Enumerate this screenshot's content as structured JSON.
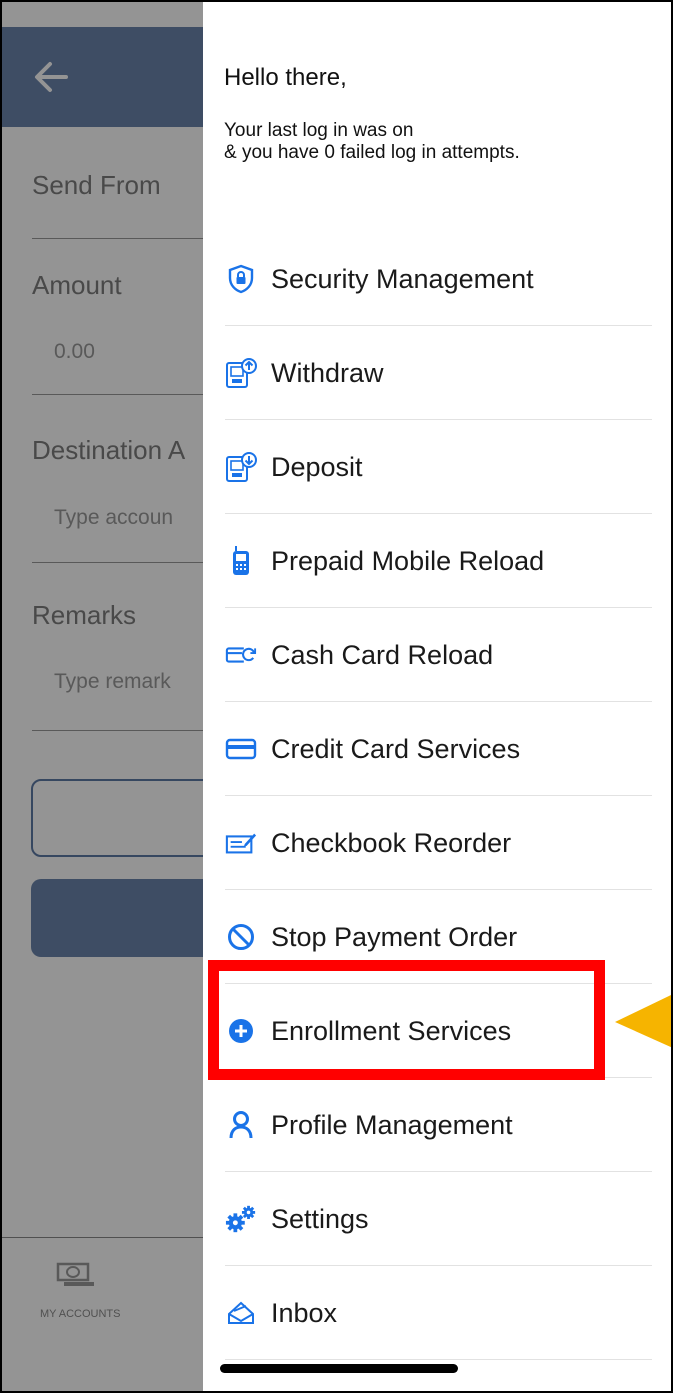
{
  "background": {
    "fields": [
      {
        "label": "Send From"
      },
      {
        "label": "Amount",
        "placeholder": "0.00"
      },
      {
        "label": "Destination A",
        "placeholder": "Type accoun"
      },
      {
        "label": "Remarks",
        "placeholder": "Type remark"
      }
    ],
    "tab_bar": {
      "my_accounts_label": "MY ACCOUNTS"
    }
  },
  "drawer": {
    "greeting": "Hello there,",
    "last_login_line1": "Your last log in was on",
    "last_login_line2": "& you have 0 failed log in attempts.",
    "items": [
      {
        "label": "Security Management",
        "icon": "shield-lock-icon"
      },
      {
        "label": "Withdraw",
        "icon": "atm-withdraw-icon"
      },
      {
        "label": "Deposit",
        "icon": "atm-deposit-icon"
      },
      {
        "label": "Prepaid Mobile Reload",
        "icon": "mobile-phone-icon"
      },
      {
        "label": "Cash Card Reload",
        "icon": "cash-card-reload-icon"
      },
      {
        "label": "Credit Card Services",
        "icon": "credit-card-icon"
      },
      {
        "label": "Checkbook Reorder",
        "icon": "checkbook-icon"
      },
      {
        "label": "Stop Payment Order",
        "icon": "stop-icon"
      },
      {
        "label": "Enrollment Services",
        "icon": "plus-circle-icon"
      },
      {
        "label": "Profile Management",
        "icon": "person-icon"
      },
      {
        "label": "Settings",
        "icon": "gears-icon"
      },
      {
        "label": "Inbox",
        "icon": "envelope-open-icon"
      }
    ]
  },
  "colors": {
    "icon_blue": "#1a73e8",
    "highlight_red": "#ff0000",
    "arrow_yellow": "#f6b400",
    "header_blue": "#6b86ad"
  }
}
